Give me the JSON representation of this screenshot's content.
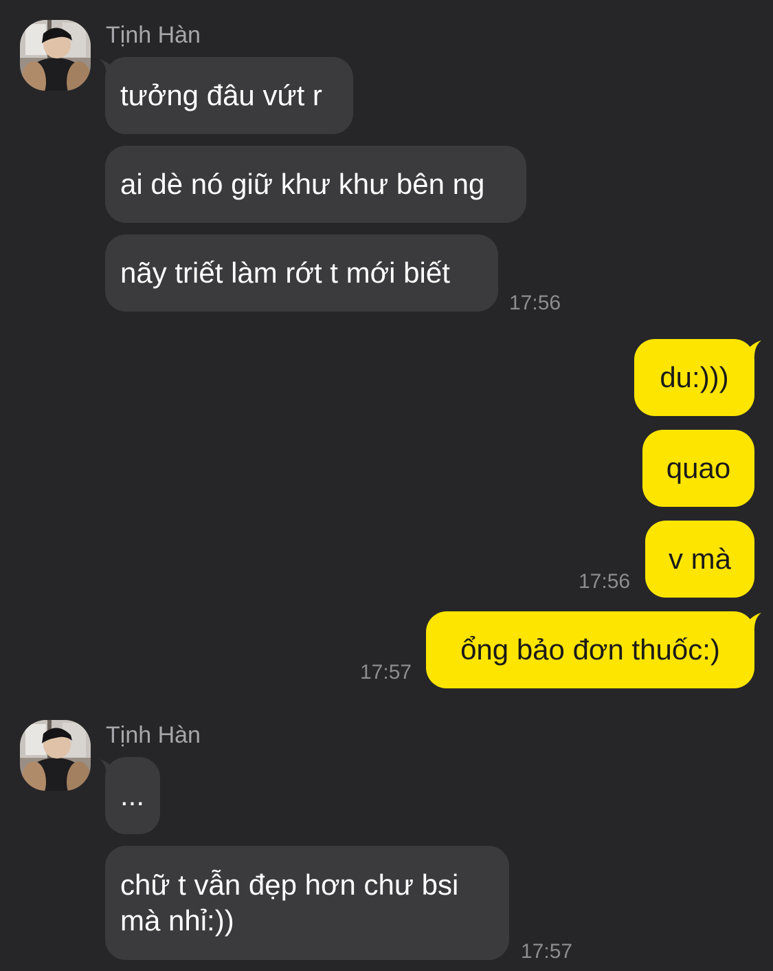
{
  "chat": {
    "groups": [
      {
        "sender": "Tịnh Hàn",
        "messages": [
          "tưởng đâu vứt r",
          "ai dè nó giữ khư khư bên ng",
          "nãy triết làm rớt t mới biết"
        ],
        "time": "17:56"
      },
      {
        "sender": "me",
        "messages": [
          "du:)))",
          "quao",
          "v mà"
        ],
        "time": "17:56"
      },
      {
        "sender": "me",
        "messages": [
          "ổng bảo đơn thuốc:)"
        ],
        "time": "17:57"
      },
      {
        "sender": "Tịnh Hàn",
        "messages": [
          "...",
          "chữ t vẫn đẹp hơn chư bsi mà nhỉ:))"
        ],
        "time": "17:57"
      }
    ]
  },
  "colors": {
    "background": "#262628",
    "incoming_bubble": "#3b3b3d",
    "outgoing_bubble": "#fee500"
  },
  "icons": {
    "avatar": "profile-photo"
  }
}
